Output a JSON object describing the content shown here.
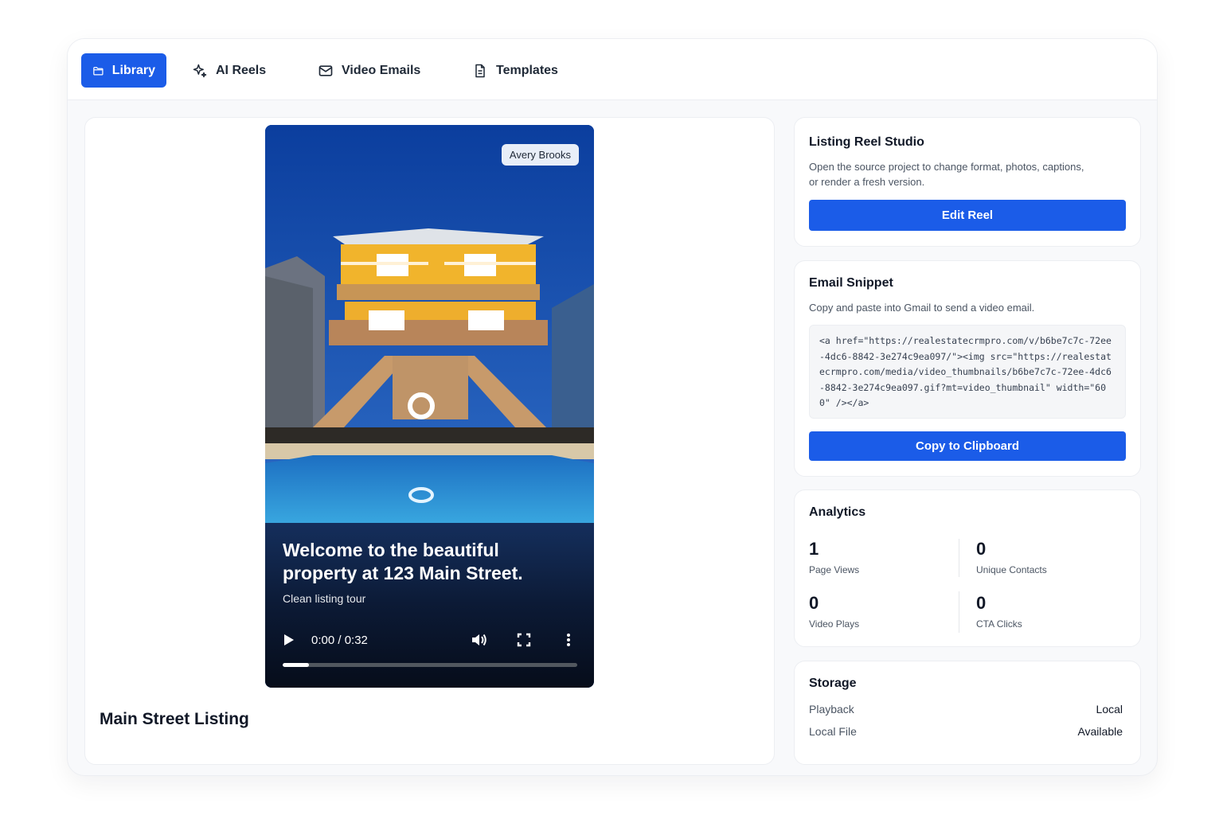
{
  "tabs": [
    {
      "label": "Library",
      "icon": "folder-icon",
      "active": true
    },
    {
      "label": "AI Reels",
      "icon": "sparkles-icon",
      "active": false
    },
    {
      "label": "Video Emails",
      "icon": "mail-icon",
      "active": false
    },
    {
      "label": "Templates",
      "icon": "document-icon",
      "active": false
    }
  ],
  "video": {
    "badge": "Avery Brooks",
    "caption_title": "Welcome to the beautiful property at 123 Main Street.",
    "caption_sub": "Clean listing tour",
    "time": "0:00 / 0:32",
    "progress": 0.09
  },
  "listing": {
    "title": "Main Street Listing"
  },
  "reel_studio": {
    "title": "Listing Reel Studio",
    "description": "Open the source project to change format, photos, captions, or render a fresh version.",
    "button": "Edit Reel"
  },
  "email_snippet": {
    "title": "Email Snippet",
    "description": "Copy and paste into Gmail to send a video email.",
    "code": "<a href=\"https://realestatecrmpro.com/v/b6be7c7c-72ee-4dc6-8842-3e274c9ea097/\"><img src=\"https://realestatecrmpro.com/media/video_thumbnails/b6be7c7c-72ee-4dc6-8842-3e274c9ea097.gif?mt=video_thumbnail\" width=\"600\" /></a>",
    "button": "Copy to Clipboard"
  },
  "analytics": {
    "title": "Analytics",
    "stats": [
      {
        "value": "1",
        "label": "Page Views"
      },
      {
        "value": "0",
        "label": "Unique Contacts"
      },
      {
        "value": "0",
        "label": "Video Plays"
      },
      {
        "value": "0",
        "label": "CTA Clicks"
      }
    ]
  },
  "storage": {
    "title": "Storage",
    "rows": [
      {
        "key": "Playback",
        "value": "Local"
      },
      {
        "key": "Local File",
        "value": "Available"
      }
    ]
  },
  "colors": {
    "accent": "#1b5ce8",
    "text": "#111827",
    "muted": "#4b5563",
    "background": "#f8f9fb"
  }
}
